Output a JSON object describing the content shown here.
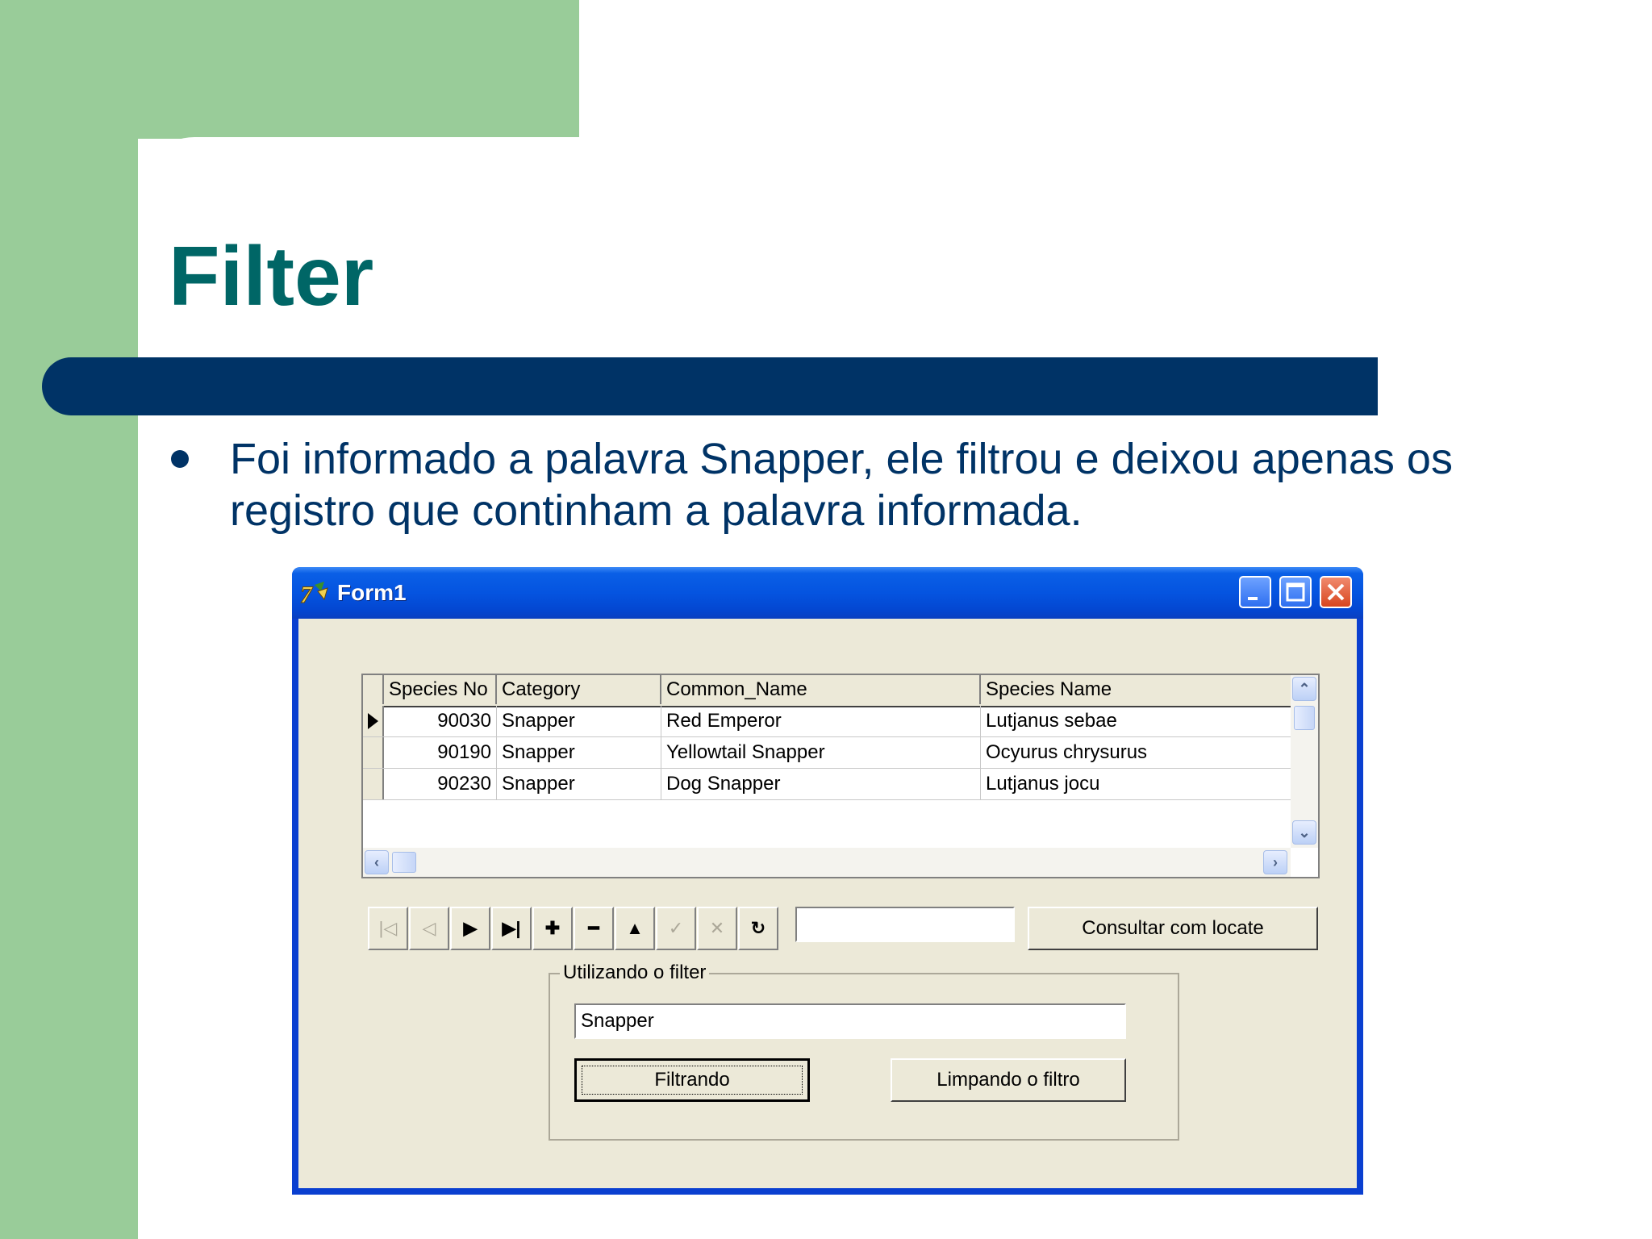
{
  "slide": {
    "title": "Filter",
    "bullet": "Foi informado a palavra Snapper, ele filtrou e deixou apenas os registro que continham a palavra informada."
  },
  "window": {
    "title": "Form1",
    "icon": "delphi-app-icon"
  },
  "grid": {
    "columns": [
      "Species No",
      "Category",
      "Common_Name",
      "Species Name"
    ],
    "rows": [
      {
        "species_no": "90030",
        "category": "Snapper",
        "common_name": "Red Emperor",
        "species_name": "Lutjanus sebae"
      },
      {
        "species_no": "90190",
        "category": "Snapper",
        "common_name": "Yellowtail Snapper",
        "species_name": "Ocyurus chrysurus"
      },
      {
        "species_no": "90230",
        "category": "Snapper",
        "common_name": "Dog Snapper",
        "species_name": "Lutjanus jocu"
      }
    ],
    "current_row": 0
  },
  "navigator": {
    "buttons": [
      {
        "name": "first-icon",
        "glyph": "|◁",
        "enabled": false
      },
      {
        "name": "prior-icon",
        "glyph": "◁",
        "enabled": false
      },
      {
        "name": "next-icon",
        "glyph": "▶",
        "enabled": true
      },
      {
        "name": "last-icon",
        "glyph": "▶|",
        "enabled": true
      },
      {
        "name": "insert-icon",
        "glyph": "✚",
        "enabled": true
      },
      {
        "name": "delete-icon",
        "glyph": "━",
        "enabled": true
      },
      {
        "name": "edit-icon",
        "glyph": "▲",
        "enabled": true
      },
      {
        "name": "post-icon",
        "glyph": "✓",
        "enabled": false
      },
      {
        "name": "cancel-icon",
        "glyph": "✕",
        "enabled": false
      },
      {
        "name": "refresh-icon",
        "glyph": "↻",
        "enabled": true
      }
    ]
  },
  "locate": {
    "value": "",
    "button_label": "Consultar com locate"
  },
  "filter_group": {
    "caption": "Utilizando o filter",
    "value": "Snapper",
    "apply_label": "Filtrando",
    "clear_label": "Limpando o filtro"
  },
  "colors": {
    "slide_green": "#99cc99",
    "title_teal": "#006666",
    "navy": "#003366",
    "xp_blue": "#0554e0",
    "form_face": "#ece9d8"
  }
}
